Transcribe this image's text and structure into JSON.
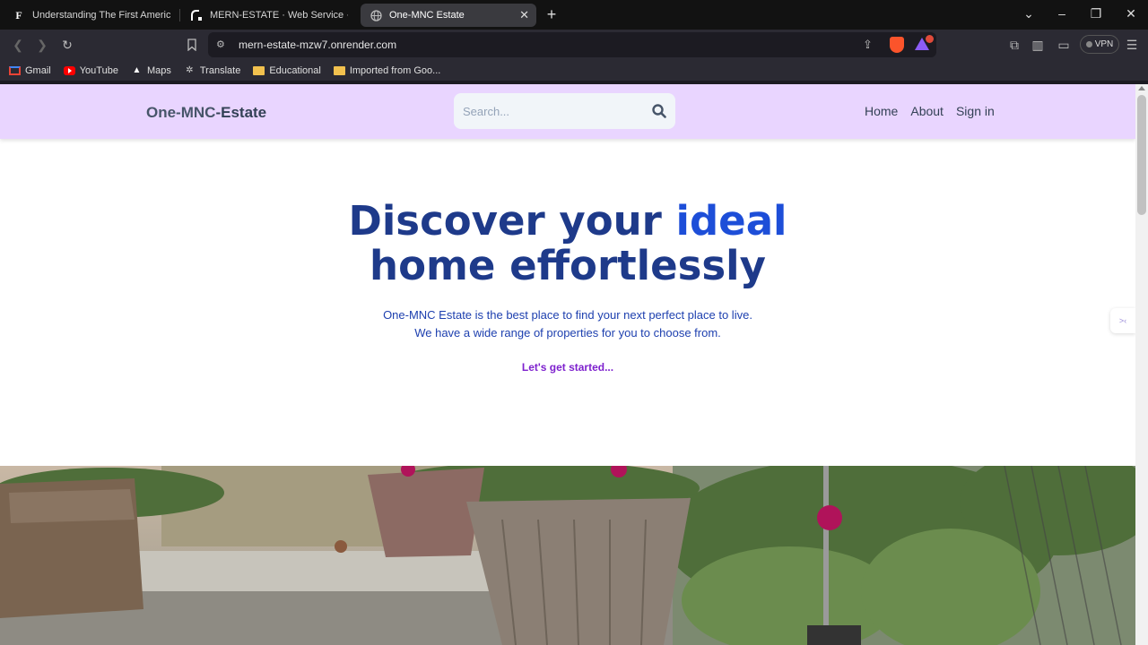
{
  "tabs": [
    {
      "title": "Understanding The First American Fi",
      "favicon": "F"
    },
    {
      "title": "MERN-ESTATE · Web Service · Rend",
      "favicon": "render-icon"
    },
    {
      "title": "One-MNC Estate",
      "favicon": "globe-icon",
      "active": true
    }
  ],
  "address": {
    "url": "mern-estate-mzw7.onrender.com"
  },
  "toolbar": {
    "vpn_label": "VPN",
    "shield_badge": "1"
  },
  "bookmarks": [
    {
      "label": "Gmail",
      "icon": "gmail-icon"
    },
    {
      "label": "YouTube",
      "icon": "youtube-icon"
    },
    {
      "label": "Maps",
      "icon": "maps-icon"
    },
    {
      "label": "Translate",
      "icon": "translate-icon"
    },
    {
      "label": "Educational",
      "icon": "folder-icon"
    },
    {
      "label": "Imported from Goo...",
      "icon": "folder-icon"
    }
  ],
  "site": {
    "logo_part1": "One-MNC",
    "logo_part2": "-Estate",
    "search_placeholder": "Search...",
    "nav": [
      "Home",
      "About",
      "Sign in"
    ]
  },
  "hero": {
    "title_part1": "Discover your ",
    "title_accent": "ideal",
    "title_part2": "home effortlessly",
    "subtitle_line1": "One-MNC Estate is the best place to find your next perfect place to live.",
    "subtitle_line2": "We have a wide range of properties for you to choose from.",
    "cta": "Let's get started..."
  },
  "colors": {
    "header_bg": "#e9d5ff",
    "title": "#1e3a8a",
    "accent": "#1d4ed8",
    "cta": "#7e22ce"
  }
}
